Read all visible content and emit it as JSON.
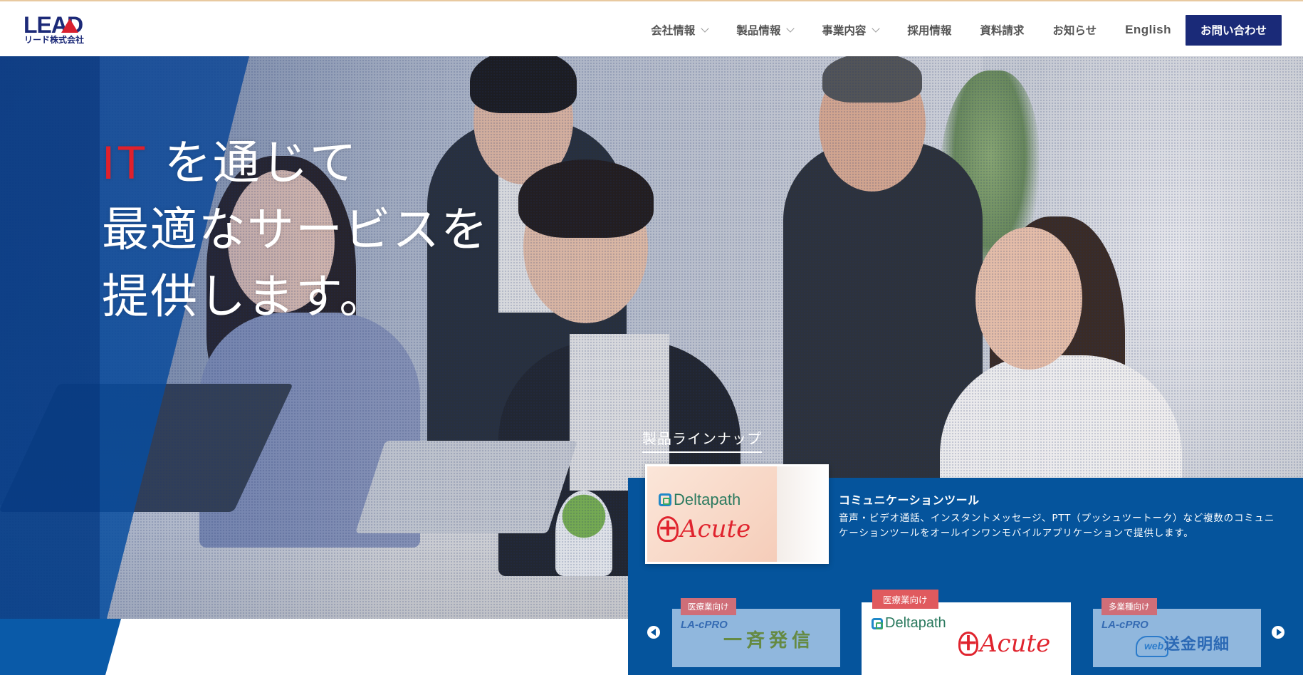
{
  "logo": {
    "word": "LEAD",
    "sub": "リード株式会社"
  },
  "nav": {
    "items": [
      {
        "label": "会社情報",
        "has_dropdown": true
      },
      {
        "label": "製品情報",
        "has_dropdown": true
      },
      {
        "label": "事業内容",
        "has_dropdown": true
      },
      {
        "label": "採用情報",
        "has_dropdown": false
      },
      {
        "label": "資料請求",
        "has_dropdown": false
      },
      {
        "label": "お知らせ",
        "has_dropdown": false
      },
      {
        "label": "English",
        "has_dropdown": false
      }
    ],
    "contact_label": "お問い合わせ"
  },
  "hero": {
    "line1_accent": "IT",
    "line1_rest": " を通じて",
    "line2": "最適なサービスを",
    "line3": "提供します。"
  },
  "lineup": {
    "title": "製品ラインナップ",
    "feature": {
      "brand_top": "Deltapath",
      "brand_bottom": "Acute",
      "title": "コミュニケーションツール",
      "description": "音声・ビデオ通話、インスタントメッセージ、PTT（プッシュツートーク）など複数のコミュニケーションツールをオールインワンモバイルアプリケーションで提供します。"
    },
    "cards": [
      {
        "badge": "医療業向け",
        "brand": "LA-cPRO",
        "text": "一斉発信",
        "active": false
      },
      {
        "badge": "医療業向け",
        "brand": "Deltapath",
        "text": "Acute",
        "active": true
      },
      {
        "badge": "多業種向け",
        "brand": "LA-cPRO",
        "text": "送金明細",
        "prefix": "web",
        "active": false
      }
    ]
  },
  "colors": {
    "navy": "#1a2a78",
    "brand_red": "#e0202c",
    "panel_blue": "#05549c",
    "badge_red": "#e05a5e",
    "badge_dim": "#cf6e78"
  },
  "icons": {
    "prev": "chevron-left-circle-icon",
    "next": "chevron-right-circle-icon",
    "dropdown": "chevron-down-icon"
  }
}
